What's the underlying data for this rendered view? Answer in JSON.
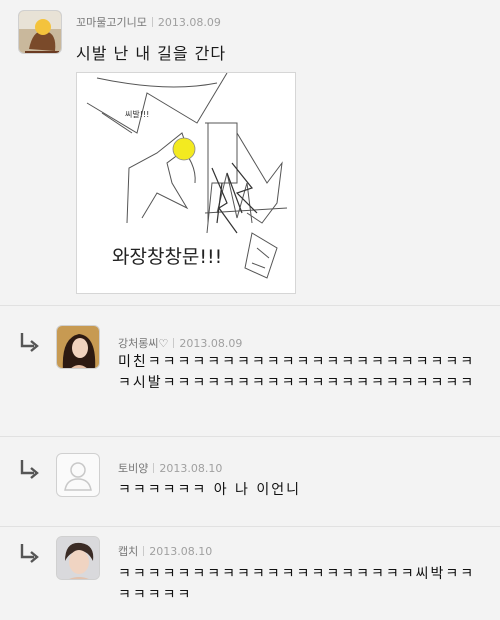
{
  "post": {
    "author": "꼬마물고기니모",
    "date": "2013.08.09",
    "text": "시발 난 내 길을 간다",
    "drawing": {
      "small_text": "씨발!!!",
      "big_text": "와장창창문!!!"
    }
  },
  "comments": [
    {
      "author": "강처롱씨♡",
      "date": "2013.08.09",
      "text": "미친ㅋㅋㅋㅋㅋㅋㅋㅋㅋㅋㅋㅋㅋㅋㅋㅋㅋㅋㅋㅋㅋㅋㅋ시발ㅋㅋㅋㅋㅋㅋㅋㅋㅋㅋㅋㅋㅋㅋㅋㅋㅋㅋㅋㅋㅋ"
    },
    {
      "author": "토비양",
      "date": "2013.08.10",
      "text": "ㅋㅋㅋㅋㅋㅋ 아 나 이언니"
    },
    {
      "author": "캡치",
      "date": "2013.08.10",
      "text": "ㅋㅋㅋㅋㅋㅋㅋㅋㅋㅋㅋㅋㅋㅋㅋㅋㅋㅋㅋㅋ씨박ㅋㅋㅋㅋㅋㅋㅋ"
    }
  ],
  "icons": {
    "reply": "reply-arrow-icon",
    "default_avatar": "user-silhouette-icon"
  },
  "colors": {
    "background": "#f3f3f3",
    "meta_text": "#a0a0a0",
    "reply_arrow": "#555555"
  }
}
